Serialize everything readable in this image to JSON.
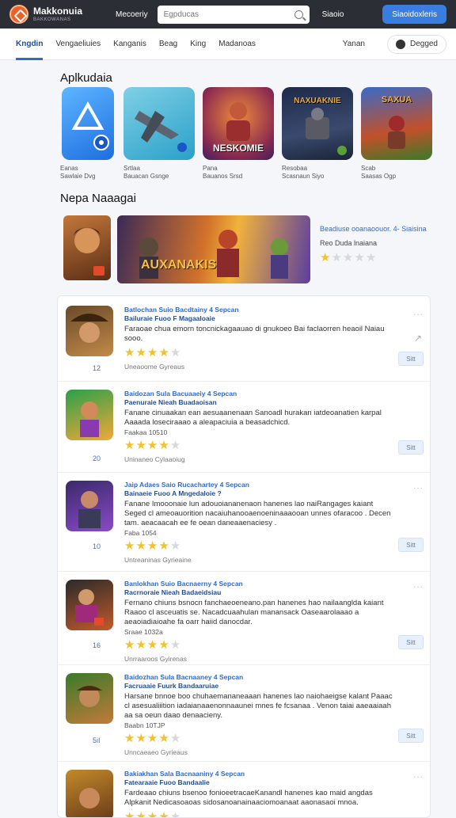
{
  "header": {
    "logo_title": "Makkonuia",
    "logo_subtitle": "BAKKOWANAS",
    "nav_link": "Mecoeriy",
    "search_placeholder": "Egpducas",
    "right_link": "Siaoio",
    "cta_label": "Siaoidoxleris"
  },
  "tabs": {
    "items": [
      "Kngdin",
      "Vengaeliuies",
      "Kanganis",
      "Beag",
      "King",
      "Madanoas"
    ],
    "active_index": 0,
    "right_label": "Yanan",
    "right_button": "Degged"
  },
  "featured": {
    "title": "Aplkudaia",
    "apps": [
      {
        "name": "Eanas",
        "dev": "Sawlaie Dvg",
        "overlay": ""
      },
      {
        "name": "Srtlaa",
        "dev": "Bauacan Gsnge",
        "overlay": ""
      },
      {
        "name": "Pana",
        "dev": "Bauanos Srsd",
        "overlay": "NESKOMIE"
      },
      {
        "name": "Resobaa",
        "dev": "Scasnaun Siyo",
        "overlay": "NAXUAKNIE"
      },
      {
        "name": "Scab",
        "dev": "Saasas Ogp",
        "overlay": "SAXUA"
      }
    ]
  },
  "banner": {
    "title": "Nepa Naaagai",
    "main_overlay": "AUXANAKIS",
    "line1": "Beadiuse ooanaoouor. 4- Siaisina",
    "line2": "Reo Duda lnaiana",
    "rating": 1
  },
  "list": {
    "items": [
      {
        "title": "Batlochan Suio  Bacdtainy  4  Sepcan",
        "subtitle": "Bailuraie  Fuoo  F  Magaaloaie",
        "desc": "Faraoae chua emorn  toncnickagaauao di gnukoeo Bai faclaorren heaoil Naiau sooo.",
        "meta": "",
        "rating": 4,
        "count": "12",
        "category": "Uneaoome  Gyreaus",
        "button": "Sitt"
      },
      {
        "title": "Baidozan Sula  Bacuaaeiy  4  Sepcan",
        "subtitle": "Paenuraie  Nieah  Buadaoisan",
        "desc": "Fanane  cinuaakan  ean aesuaanenaan  Sanoadl  hurakan  iatdeoanatien  karpal Aaaada  loseciraaao  a aleapaciuia a  beasadchicd.",
        "meta": "Faakaa  10510",
        "rating": 4,
        "count": "20",
        "category": "Uninaneo  Cylaaoiug",
        "button": "Sitt"
      },
      {
        "title": "Jaip Adaes Saio  Rucachartey  4  Sepcan",
        "subtitle": "Bainaeie  Fuoo  A  Mngedaloie  ?",
        "desc": "Fanane  Imooonaie  lun  adouoiananenaon  hanenes  lao  naiRangages  kaiant Seged  cl  ameoauorition  nacaiuhanooaenoeninaaaooan  unnes  ofaracoo . Decen  tam.  aeacaacah  ee  fe  oean  daneaaenaciesy .",
        "meta": "Faba  1054",
        "rating": 4,
        "count": "10",
        "category": "Untreaninas  Gyrieaine",
        "button": "Sitt"
      },
      {
        "title": "Banlokhan Suio  Bacnaerny  4  Sepcan",
        "subtitle": "Racrnoraie  Nieah  Badaeidsiau",
        "desc": "Fernano  chiuns  bsnocn  fanchaeoeneano.pan  hanenes  hao  nailaanglda  kaiant Raaoo  cl  asceuatis  se.  Nacadcuaahulan  manansack Oaseaarolaaao  a  aeaoiadiaioahe  fa  oarr  haiid  danocdar.",
        "meta": "Sraae  1032a",
        "rating": 4,
        "count": "16",
        "category": "Unrraaroos  Gyirenas",
        "button": "Sitt"
      },
      {
        "title": "Baidozhan Sula  Bacnaaney  4  Sepcan",
        "subtitle": "Facruaaie  Fuurk  Bandaaruiae",
        "desc": "Harsane  bnnoe  boo  chuhaemananeaaan  hanenes  lao  naiohaeigse  kalant Paaac  cl  asesualiiition  iadaianaaenonnaaunei  mnes  fe  fcsanaa . Venon  taiai  aaeaaiaah  aa  sa  oeun  daao  denaacieny.",
        "meta": "Baabn  10TJP",
        "rating": 4,
        "count": "5iI",
        "category": "Unncaeaeo  Gyrieaus",
        "button": "Sitt"
      },
      {
        "title": "Bakiakhan Sala  Bacnaaniny  4  Sepcan",
        "subtitle": "Fatearaaie  Fuoo  Bandaalie",
        "desc": "Fardeaao  chiuns  bsenoo  fonioeetracaeKanandl  hanenes  kao  maid  angdas  Alpkanit Nedicasoaoas  sidosanoanainaaciomoanaat  aaonasaoi  mnoa.",
        "meta": "",
        "rating": 4,
        "count": "",
        "category": "",
        "button": ""
      }
    ]
  }
}
